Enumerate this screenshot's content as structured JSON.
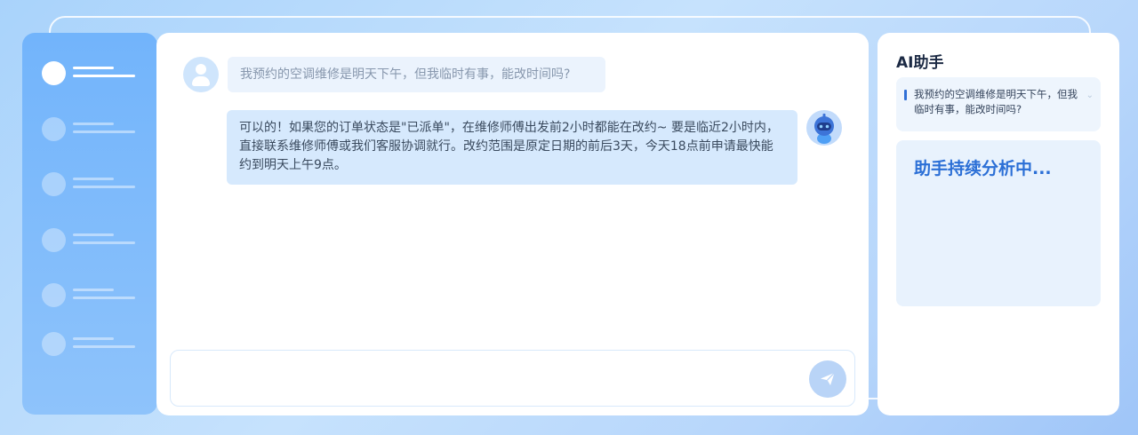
{
  "chat": {
    "user_message": "我预约的空调维修是明天下午，但我临时有事，能改时间吗?",
    "bot_message": "可以的！如果您的订单状态是\"已派单\"，在维修师傅出发前2小时都能在改约~ 要是临近2小时内，直接联系维修师傅或我们客服协调就行。改约范围是原定日期的前后3天，今天18点前申请最快能约到明天上午9点。",
    "input_value": ""
  },
  "assistant": {
    "title": "AI助手",
    "query": "我预约的空调维修是明天下午，但我临时有事，能改时间吗?",
    "status": "助手持续分析中..."
  },
  "sidebar": {
    "items": [
      {
        "icon": "nav-dot-icon",
        "active": true
      },
      {
        "icon": "nav-dot-icon",
        "active": false
      },
      {
        "icon": "nav-dot-icon",
        "active": false
      },
      {
        "icon": "nav-dot-icon",
        "active": false
      },
      {
        "icon": "nav-dot-icon",
        "active": false
      },
      {
        "icon": "nav-dot-icon",
        "active": false
      }
    ]
  },
  "icons": {
    "send": "send-icon",
    "user_avatar": "user-avatar-icon",
    "bot_avatar": "robot-avatar-icon",
    "expand": "chevron-down-icon"
  },
  "colors": {
    "accent": "#2b6fd6",
    "sidebar": "#72b4fb",
    "bot_bubble": "#d6e9fd",
    "user_bubble": "#ebf3fd"
  }
}
